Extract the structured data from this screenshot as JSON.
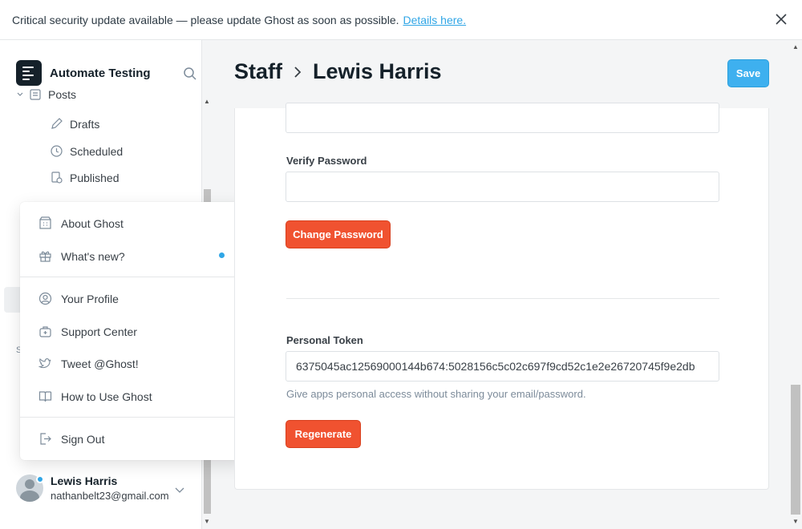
{
  "banner": {
    "message": "Critical security update available — please update Ghost as soon as possible.",
    "link_text": "Details here."
  },
  "sidebar": {
    "site_title": "Automate Testing",
    "nav": {
      "posts": "Posts",
      "drafts": "Drafts",
      "scheduled": "Scheduled",
      "published": "Published"
    },
    "section_letter": "S"
  },
  "menu": {
    "items": [
      {
        "label": "About Ghost",
        "icon": "building-icon"
      },
      {
        "label": "What's new?",
        "icon": "gift-icon"
      },
      {
        "label": "Your Profile",
        "icon": "user-circle-icon"
      },
      {
        "label": "Support Center",
        "icon": "support-icon"
      },
      {
        "label": "Tweet @Ghost!",
        "icon": "twitter-icon"
      },
      {
        "label": "How to Use Ghost",
        "icon": "book-icon"
      },
      {
        "label": "Sign Out",
        "icon": "sign-out-icon"
      }
    ]
  },
  "user": {
    "name": "Lewis Harris",
    "email": "nathanbelt23@gmail.com"
  },
  "header": {
    "breadcrumb_parent": "Staff",
    "breadcrumb_current": "Lewis Harris",
    "save_label": "Save"
  },
  "form": {
    "new_password_value": "",
    "verify_password_label": "Verify Password",
    "verify_password_value": "",
    "change_password_label": "Change Password",
    "personal_token_label": "Personal Token",
    "personal_token_value": "6375045ac12569000144b674:5028156c5c02c697f9cd52c1e2e26720745f9e2db",
    "personal_token_hint": "Give apps personal access without sharing your email/password.",
    "regenerate_label": "Regenerate"
  },
  "colors": {
    "accent_blue": "#3eb0ef",
    "danger_red": "#f05230",
    "notification_dot": "#30a6e6"
  }
}
